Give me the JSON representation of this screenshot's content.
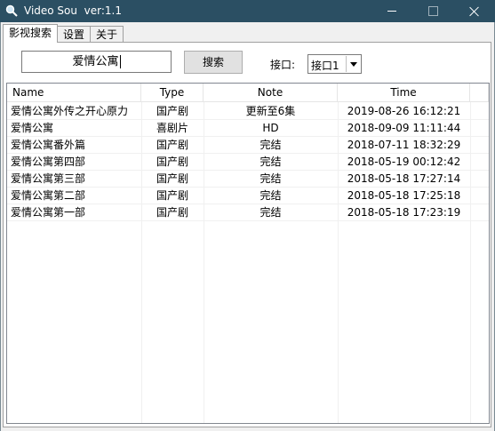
{
  "window": {
    "title": "Video Sou  ver:1.1",
    "icon": "magnifier-icon"
  },
  "tabs": [
    {
      "label": "影视搜索",
      "active": true
    },
    {
      "label": "设置",
      "active": false
    },
    {
      "label": "关于",
      "active": false
    }
  ],
  "search": {
    "value": "爱情公寓",
    "button_label": "搜索",
    "api_label": "接口:",
    "api_selected": "接口1"
  },
  "table": {
    "columns": [
      "Name",
      "Type",
      "Note",
      "Time"
    ],
    "rows": [
      {
        "name": "爱情公寓外传之开心原力",
        "type": "国产剧",
        "note": "更新至6集",
        "time": "2019-08-26 16:12:21"
      },
      {
        "name": "爱情公寓",
        "type": "喜剧片",
        "note": "HD",
        "time": "2018-09-09 11:11:44"
      },
      {
        "name": "爱情公寓番外篇",
        "type": "国产剧",
        "note": "完结",
        "time": "2018-07-11 18:32:29"
      },
      {
        "name": "爱情公寓第四部",
        "type": "国产剧",
        "note": "完结",
        "time": "2018-05-19 00:12:42"
      },
      {
        "name": "爱情公寓第三部",
        "type": "国产剧",
        "note": "完结",
        "time": "2018-05-18 17:27:14"
      },
      {
        "name": "爱情公寓第二部",
        "type": "国产剧",
        "note": "完结",
        "time": "2018-05-18 17:25:18"
      },
      {
        "name": "爱情公寓第一部",
        "type": "国产剧",
        "note": "完结",
        "time": "2018-05-18 17:23:19"
      }
    ]
  },
  "colors": {
    "titlebar": "#2b4f63",
    "window_bg": "#f0f0f0"
  }
}
